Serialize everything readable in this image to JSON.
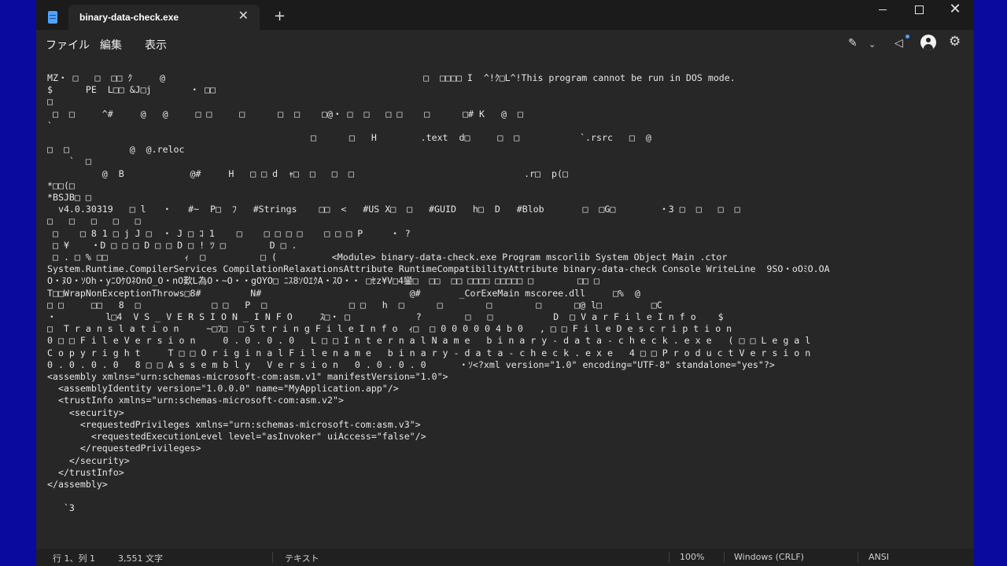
{
  "window": {
    "tab_title": "binary-data-check.exe",
    "tab_close_glyph": "✕",
    "new_tab_glyph": "+",
    "minimize_label": "",
    "maximize_label": "",
    "close_glyph": "✕"
  },
  "menu": {
    "file": "ファイル",
    "edit": "編集",
    "view": "表示"
  },
  "toolbar_icons": {
    "copilot": "copilot-icon",
    "copilot_glyph": "✎",
    "chevron_glyph": "⌄",
    "megaphone_glyph": "◁",
    "gear_glyph": "⚙"
  },
  "editor": {
    "lines": [
      "MZ・ □   □  □□ ｸ     @                                               □  □□□□ I  ^!ｸ□L^!This program cannot be run in DOS mode.",
      "$      PE  L□□ &J□j       ・ □□",
      "□",
      " □  □     ^#     @   @     □ □     □      □  □    □@・ □  □   □ □    □      □# K   @  □",
      "`",
      "                                                □      □   H        .text  d□     □  □           `.rsrc   □  @",
      "□  □           @  @.reloc",
      "    `  □",
      "          @  B            @#     H   □ □ d  ｬ□  □   □  □                               .r□  p(□",
      "*□□(□",
      "*BSJB□ □",
      "  v4.0.30319   □ l   ・   #~  P□  ﾌ   #Strings    □□  <   #US X□  □   #GUID   h□  D   #Blob       □  □G□        ・3 □  □   □  □",
      "□   □   □   □   □",
      " □    □ 8 1 □ j J □  ・ J □ ｺ 1    □    □ □ □ □    □ □ □ P     ・ ?",
      " □ ¥    ・D □ □ □ D □ □ D □ ! ﾂ □        D □ .",
      " □ . □ % □□              ｨ  □          □ (          <Module> binary-data-check.exe Program mscorlib System Object Main .ctor",
      "System.Runtime.CompilerServices CompilationRelaxationsAttribute RuntimeCompatibilityAttribute binary-data-check Console WriteLine  9SO・oOﾐO.OA",
      "O・ﾇO・ｿOh・yﾆOｹOﾈOnO_O・nO歎L為O・~O・・gOYO□ ﾆｽ8ｿOｴｸA・ｽO・・ □ｾz¥V□4鑾□  □□  □□ □□□□ □□□□□ □        □□ □",
      "T□□WrapNonExceptionThrows□8#         N#                           @#       _CorExeMain mscoree.dll     □%  @",
      "□ □     □□   8  □             □ □   P  □               □ □   h  □      □        □        □      □@ l□         □C",
      "・         l□4  V S _ V E R S I O N _ I N F O     ｽ□・ □            ?        □   □           D  □ V a r F i l e I n f o    $",
      "□  T r a n s l a t i o n     ~□ﾌ□  □ S t r i n g F i l e I n f o  ｨ□  □ 0 0 0 0 0 4 b 0   , □ □ F i l e D e s c r i p t i o n",
      "0 □ □ F i l e V e r s i o n     0 . 0 . 0 . 0   L □ □ I n t e r n a l N a m e   b i n a r y - d a t a - c h e c k . e x e   ( □ □ L e g a l",
      "C o p y r i g h t     T □ □ O r i g i n a l F i l e n a m e   b i n a r y - d a t a - c h e c k . e x e   4 □ □ P r o d u c t V e r s i o n",
      "0 . 0 . 0 . 0   8 □ □ A s s e m b l y   V e r s i o n   0 . 0 . 0 . 0      ・ｿ<?xml version=\"1.0\" encoding=\"UTF-8\" standalone=\"yes\"?>",
      "<assembly xmlns=\"urn:schemas-microsoft-com:asm.v1\" manifestVersion=\"1.0\">",
      "  <assemblyIdentity version=\"1.0.0.0\" name=\"MyApplication.app\"/>",
      "  <trustInfo xmlns=\"urn:schemas-microsoft-com:asm.v2\">",
      "    <security>",
      "      <requestedPrivileges xmlns=\"urn:schemas-microsoft-com:asm.v3\">",
      "        <requestedExecutionLevel level=\"asInvoker\" uiAccess=\"false\"/>",
      "      </requestedPrivileges>",
      "    </security>",
      "  </trustInfo>",
      "</assembly>",
      "",
      "   `3"
    ]
  },
  "status": {
    "position": "行 1、列 1",
    "char_count": "3,551 文字",
    "format": "テキスト",
    "zoom": "100%",
    "line_ending": "Windows (CRLF)",
    "encoding": "ANSI"
  }
}
